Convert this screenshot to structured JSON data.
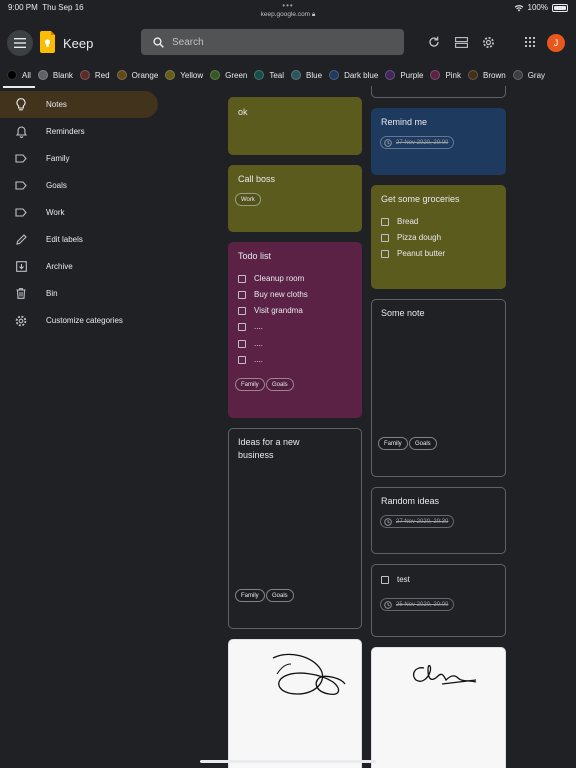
{
  "status": {
    "time": "9:00 PM",
    "date": "Thu Sep 16",
    "url": "keep.google.com",
    "battery": "100%"
  },
  "header": {
    "app_name": "Keep",
    "search_placeholder": "Search",
    "avatar_initial": "J"
  },
  "filters": [
    {
      "label": "All",
      "color": "#000000"
    },
    {
      "label": "Blank",
      "color": "#5f6368"
    },
    {
      "label": "Red",
      "color": "#5c2b29"
    },
    {
      "label": "Orange",
      "color": "#614a19"
    },
    {
      "label": "Yellow",
      "color": "#635d19"
    },
    {
      "label": "Green",
      "color": "#345920"
    },
    {
      "label": "Teal",
      "color": "#16504b"
    },
    {
      "label": "Blue",
      "color": "#2d555e"
    },
    {
      "label": "Dark blue",
      "color": "#1e3a5f"
    },
    {
      "label": "Purple",
      "color": "#42275e"
    },
    {
      "label": "Pink",
      "color": "#5b2245"
    },
    {
      "label": "Brown",
      "color": "#442f19"
    },
    {
      "label": "Gray",
      "color": "#3c3f43"
    }
  ],
  "sidebar": {
    "items": [
      {
        "label": "Notes",
        "icon": "lightbulb-icon"
      },
      {
        "label": "Reminders",
        "icon": "bell-icon"
      },
      {
        "label": "Family",
        "icon": "label-icon"
      },
      {
        "label": "Goals",
        "icon": "label-icon"
      },
      {
        "label": "Work",
        "icon": "label-icon"
      },
      {
        "label": "Edit labels",
        "icon": "pencil-icon"
      },
      {
        "label": "Archive",
        "icon": "archive-icon"
      },
      {
        "label": "Bin",
        "icon": "trash-icon"
      },
      {
        "label": "Customize categories",
        "icon": "gear-icon"
      }
    ]
  },
  "notes": {
    "ok": {
      "title": "ok"
    },
    "call_boss": {
      "title": "Call boss",
      "tags": [
        "Work"
      ]
    },
    "todo": {
      "title": "Todo list",
      "items": [
        "Cleanup room",
        "Buy new cloths",
        "Visit grandma",
        "....",
        "....",
        "...."
      ],
      "tags": [
        "Family",
        "Goals"
      ]
    },
    "ideas": {
      "title": "Ideas for a new business",
      "tags": [
        "Family",
        "Goals"
      ]
    },
    "remind": {
      "title": "Remind me",
      "reminder": "27 Nov 2020, 20:00"
    },
    "groceries": {
      "title": "Get some groceries",
      "items": [
        "Bread",
        "Pizza dough",
        "Peanut butter"
      ]
    },
    "some_note": {
      "title": "Some note",
      "tags": [
        "Family",
        "Goals"
      ]
    },
    "random": {
      "title": "Random ideas",
      "reminder": "27 Nov 2020, 20:30"
    },
    "test": {
      "item": "test",
      "reminder": "25 Nov 2020, 20:00"
    }
  },
  "colors": {
    "olive": "#5b5b1e",
    "pink": "#5b2245",
    "dark_blue": "#1e3a5f",
    "avatar": "#e8581c",
    "active_nav": "#41331c"
  }
}
